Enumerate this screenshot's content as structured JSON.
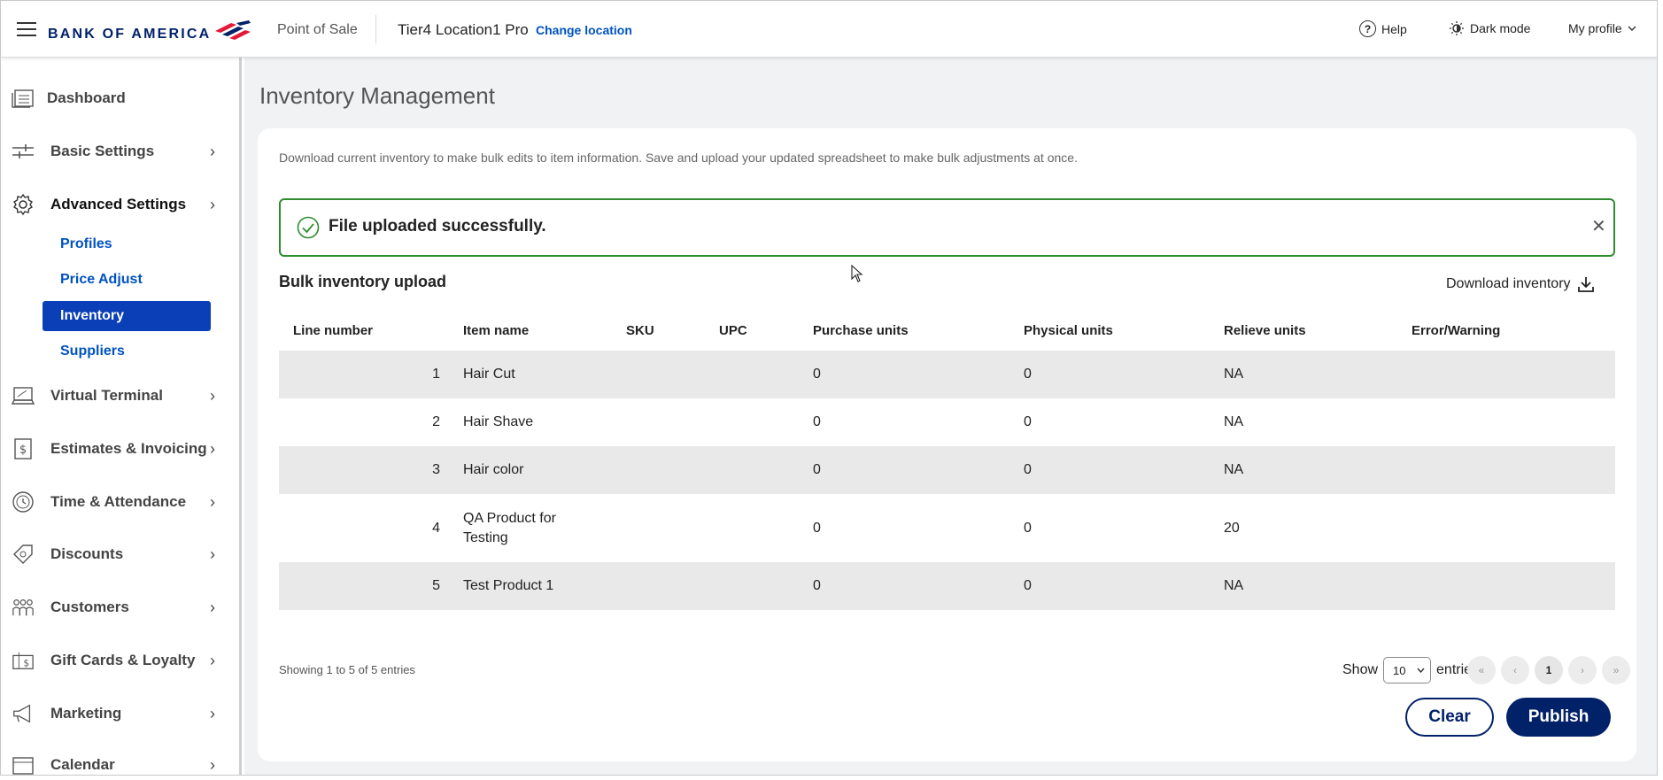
{
  "header": {
    "brand": "BANK OF AMERICA",
    "product": "Point of Sale",
    "location": "Tier4 Location1 Pro",
    "change_location": "Change location",
    "help": "Help",
    "dark_mode": "Dark mode",
    "my_profile": "My profile"
  },
  "sidebar": {
    "dashboard": "Dashboard",
    "basic_settings": "Basic Settings",
    "advanced_settings": "Advanced Settings",
    "sub": {
      "profiles": "Profiles",
      "price_adjust": "Price Adjust",
      "inventory": "Inventory",
      "suppliers": "Suppliers"
    },
    "virtual_terminal": "Virtual Terminal",
    "estimates_invoicing": "Estimates & Invoicing",
    "time_attendance": "Time & Attendance",
    "discounts": "Discounts",
    "customers": "Customers",
    "gift_cards_loyalty": "Gift Cards & Loyalty",
    "marketing": "Marketing",
    "calendar": "Calendar"
  },
  "main": {
    "title": "Inventory Management",
    "description": "Download current inventory to make bulk edits to item information. Save and upload your updated spreadsheet to make bulk adjustments at once.",
    "success_message": "File uploaded successfully.",
    "section_title": "Bulk inventory upload",
    "download_inventory": "Download inventory",
    "columns": {
      "line": "Line number",
      "item": "Item name",
      "sku": "SKU",
      "upc": "UPC",
      "purchase": "Purchase units",
      "physical": "Physical units",
      "relieve": "Relieve units",
      "error": "Error/Warning"
    },
    "rows": [
      {
        "line": "1",
        "item": "Hair Cut",
        "sku": "",
        "upc": "",
        "purchase": "0",
        "physical": "0",
        "relieve": "NA",
        "error": ""
      },
      {
        "line": "2",
        "item": "Hair Shave",
        "sku": "",
        "upc": "",
        "purchase": "0",
        "physical": "0",
        "relieve": "NA",
        "error": ""
      },
      {
        "line": "3",
        "item": "Hair color",
        "sku": "",
        "upc": "",
        "purchase": "0",
        "physical": "0",
        "relieve": "NA",
        "error": ""
      },
      {
        "line": "4",
        "item": "QA Product for Testing",
        "sku": "",
        "upc": "",
        "purchase": "0",
        "physical": "0",
        "relieve": "20",
        "error": ""
      },
      {
        "line": "5",
        "item": "Test Product 1",
        "sku": "",
        "upc": "",
        "purchase": "0",
        "physical": "0",
        "relieve": "NA",
        "error": ""
      }
    ],
    "showing": "Showing 1 to 5 of 5 entries",
    "show_label": "Show",
    "entries_value": "10",
    "entries_label": "entries",
    "pager": {
      "first": "«",
      "prev": "‹",
      "current": "1",
      "next": "›",
      "last": "»"
    },
    "clear": "Clear",
    "publish": "Publish"
  },
  "colors": {
    "brand_navy": "#012169",
    "link_blue": "#0052c2",
    "active_nav": "#0a3fb8",
    "success_green": "#2e8b2e"
  }
}
